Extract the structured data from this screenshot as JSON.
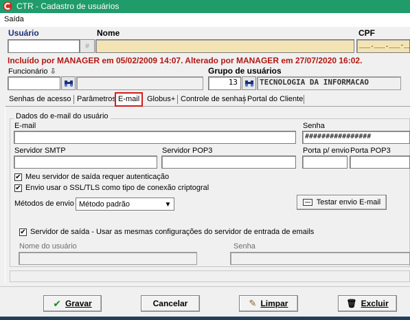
{
  "window": {
    "title": "CTR - Cadastro de usuários"
  },
  "menu": {
    "items": [
      "Saída"
    ]
  },
  "header": {
    "usuario_label": "Usuário",
    "nome_label": "Nome",
    "cpf_label": "CPF",
    "cpf_mask": "___.___.___-__",
    "info_line": "Incluído por MANAGER em 05/02/2009 14:07. Alterado por MANAGER em 27/07/2020 16:02.",
    "funcionario_label": "Funcionário ⇩",
    "grupo_label": "Grupo de usuários",
    "grupo_code": "13",
    "grupo_name": "TECNOLOGIA DA INFORMACAO",
    "usuario_btn": "#"
  },
  "tabs": [
    {
      "label": "Senhas de acesso"
    },
    {
      "label": "Parâmetros"
    },
    {
      "label": "E-mail",
      "active": true
    },
    {
      "label": "Globus+"
    },
    {
      "label": "Controle de senhas"
    },
    {
      "label": "Portal do Cliente"
    }
  ],
  "email_tab": {
    "group_title": "Dados do e-mail do usuário",
    "email_label": "E-mail",
    "email_value": "",
    "senha_label": "Senha",
    "senha_value": "################",
    "smtp_label": "Servidor SMTP",
    "pop3_label": "Servidor POP3",
    "porta_envio_label": "Porta p/ envio",
    "porta_pop3_label": "Porta POP3",
    "auth_label": "Meu servidor de saída requer autenticação",
    "auth_checked": true,
    "ssl_label": "Envio usar o SSL/TLS como tipo de conexão criptogral",
    "ssl_checked": true,
    "metodos_label": "Métodos de envio",
    "metodos_value": "Método padrão",
    "testar_label": "Testar envio E-mail",
    "same_config_label": "Servidor de saída - Usar as mesmas configurações do servidor de entrada de emails",
    "same_config_checked": true,
    "nome_usuario_label": "Nome do usuário",
    "senha2_label": "Senha"
  },
  "buttons": {
    "gravar": "Gravar",
    "cancelar": "Cancelar",
    "limpar": "Limpar",
    "excluir": "Excluir"
  },
  "colors": {
    "title_bar": "#1f9c69",
    "info_text": "#b21712",
    "label_blue": "#1a2f7c",
    "yellow_field": "#f3e4b3",
    "active_tab_border": "#d11a1a"
  }
}
